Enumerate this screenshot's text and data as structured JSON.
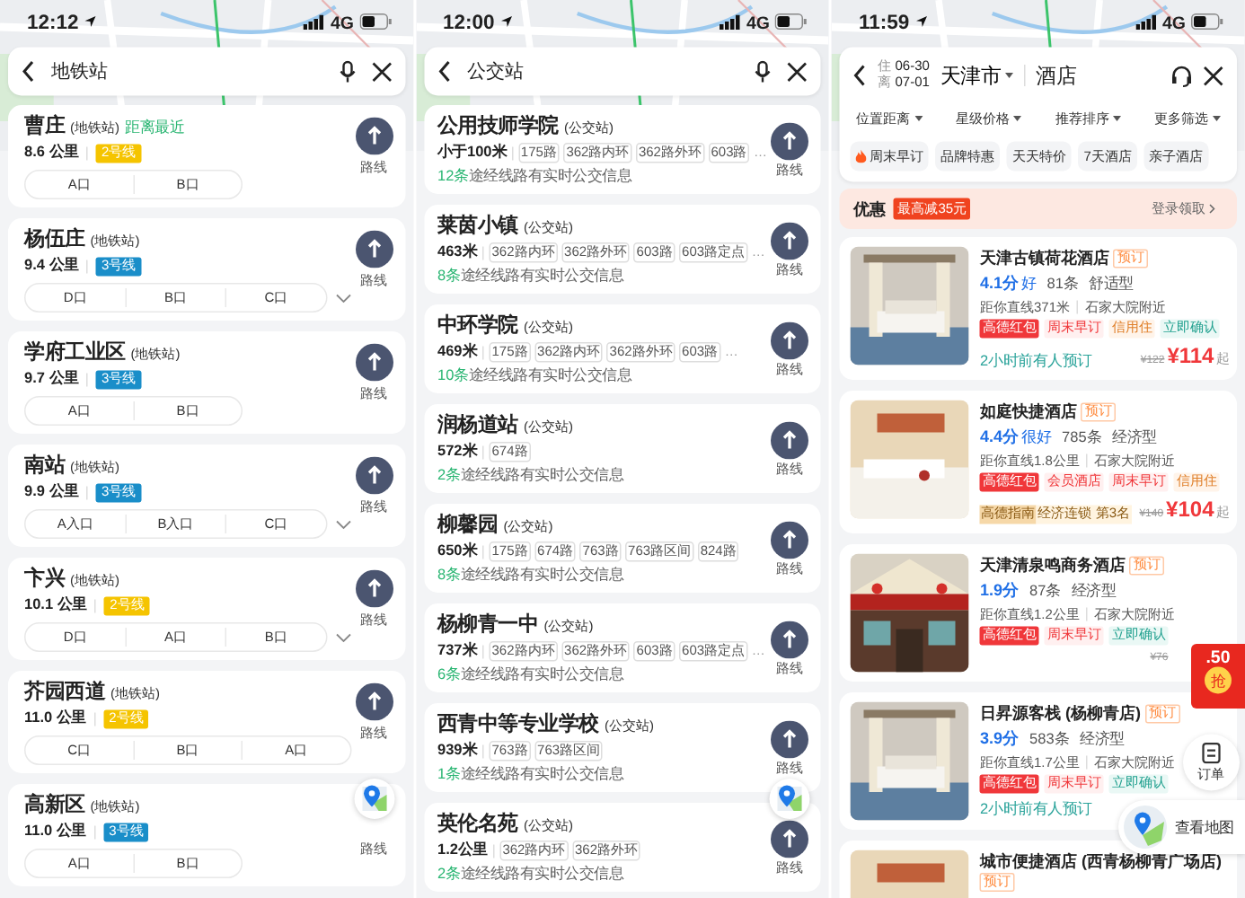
{
  "subway_screen": {
    "status_bar": {
      "time": "12:12",
      "network": "4G"
    },
    "search": {
      "query": "地铁站"
    },
    "stations": [
      {
        "name": "曹庄",
        "type": "(地铁站)",
        "note": "距离最近",
        "distance": "8.6 公里",
        "line": {
          "label": "2号线",
          "color": "#f5c400"
        },
        "exits": [
          "A口",
          "B口"
        ],
        "expandable": false,
        "route_label": "路线",
        "route_icon": true
      },
      {
        "name": "杨伍庄",
        "type": "(地铁站)",
        "distance": "9.4 公里",
        "line": {
          "label": "3号线",
          "color": "#1a8ec9"
        },
        "exits": [
          "D口",
          "B口",
          "C口"
        ],
        "expandable": true,
        "route_label": "路线",
        "route_icon": true
      },
      {
        "name": "学府工业区",
        "type": "(地铁站)",
        "distance": "9.7 公里",
        "line": {
          "label": "3号线",
          "color": "#1a8ec9"
        },
        "exits": [
          "A口",
          "B口"
        ],
        "expandable": false,
        "route_label": "路线",
        "route_icon": true
      },
      {
        "name": "南站",
        "type": "(地铁站)",
        "distance": "9.9 公里",
        "line": {
          "label": "3号线",
          "color": "#1a8ec9"
        },
        "exits": [
          "A入口",
          "B入口",
          "C口"
        ],
        "expandable": true,
        "route_label": "路线",
        "route_icon": true
      },
      {
        "name": "卞兴",
        "type": "(地铁站)",
        "distance": "10.1 公里",
        "line": {
          "label": "2号线",
          "color": "#f5c400"
        },
        "exits": [
          "D口",
          "A口",
          "B口"
        ],
        "expandable": true,
        "route_label": "路线",
        "route_icon": true
      },
      {
        "name": "芥园西道",
        "type": "(地铁站)",
        "distance": "11.0 公里",
        "line": {
          "label": "2号线",
          "color": "#f5c400"
        },
        "exits": [
          "C口",
          "B口",
          "A口"
        ],
        "expandable": false,
        "route_label": "路线",
        "route_icon": true
      },
      {
        "name": "高新区",
        "type": "(地铁站)",
        "distance": "11.0 公里",
        "line": {
          "label": "3号线",
          "color": "#1a8ec9"
        },
        "exits": [
          "A口",
          "B口"
        ],
        "expandable": false,
        "route_label": "路线",
        "route_icon": false
      }
    ]
  },
  "bus_screen": {
    "status_bar": {
      "time": "12:00",
      "network": "4G"
    },
    "search": {
      "query": "公交站"
    },
    "stops": [
      {
        "name": "公用技师学院",
        "type": "(公交站)",
        "distance": "小于100米",
        "routes": [
          "175路",
          "362路内环",
          "362路外环",
          "603路"
        ],
        "more": "…",
        "count": "12条",
        "info": "途经线路有实时公交信息",
        "route_label": "路线"
      },
      {
        "name": "莱茵小镇",
        "type": "(公交站)",
        "distance": "463米",
        "routes": [
          "362路内环",
          "362路外环",
          "603路",
          "603路定点"
        ],
        "more": "…",
        "count": "8条",
        "info": "途经线路有实时公交信息",
        "route_label": "路线"
      },
      {
        "name": "中环学院",
        "type": "(公交站)",
        "distance": "469米",
        "routes": [
          "175路",
          "362路内环",
          "362路外环",
          "603路"
        ],
        "more": "…",
        "count": "10条",
        "info": "途经线路有实时公交信息",
        "route_label": "路线"
      },
      {
        "name": "润杨道站",
        "type": "(公交站)",
        "distance": "572米",
        "routes": [
          "674路"
        ],
        "count": "2条",
        "info": "途经线路有实时公交信息",
        "route_label": "路线"
      },
      {
        "name": "柳馨园",
        "type": "(公交站)",
        "distance": "650米",
        "routes": [
          "175路",
          "674路",
          "763路",
          "763路区间",
          "824路"
        ],
        "count": "8条",
        "info": "途经线路有实时公交信息",
        "route_label": "路线"
      },
      {
        "name": "杨柳青一中",
        "type": "(公交站)",
        "distance": "737米",
        "routes": [
          "362路内环",
          "362路外环",
          "603路",
          "603路定点"
        ],
        "more": "…",
        "count": "6条",
        "info": "途经线路有实时公交信息",
        "route_label": "路线"
      },
      {
        "name": "西青中等专业学校",
        "type": "(公交站)",
        "distance": "939米",
        "routes": [
          "763路",
          "763路区间"
        ],
        "count": "1条",
        "info": "途经线路有实时公交信息",
        "route_label": "路线"
      },
      {
        "name": "英伦名苑",
        "type": "(公交站)",
        "distance": "1.2公里",
        "routes": [
          "362路内环",
          "362路外环"
        ],
        "count": "2条",
        "info": "途经线路有实时公交信息",
        "route_label": "路线"
      }
    ]
  },
  "hotel_screen": {
    "status_bar": {
      "time": "11:59",
      "network": "4G"
    },
    "header": {
      "check_in_label": "住",
      "check_in": "06-30",
      "check_out_label": "离",
      "check_out": "07-01",
      "city": "天津市",
      "category": "酒店"
    },
    "filters": [
      "位置距离",
      "星级价格",
      "推荐排序",
      "更多筛选"
    ],
    "chips": [
      {
        "label": "周末早订",
        "hot": true
      },
      {
        "label": "品牌特惠",
        "hot": false
      },
      {
        "label": "天天特价",
        "hot": false
      },
      {
        "label": "7天酒店",
        "hot": false
      },
      {
        "label": "亲子酒店",
        "hot": false
      }
    ],
    "promo": {
      "title": "优惠",
      "badge": "最高减35元",
      "action": "登录领取"
    },
    "hotels": [
      {
        "name": "天津古镇荷花酒店",
        "badge": "预订",
        "score": "4.1分",
        "rating": "好",
        "reviews": "81条",
        "class": "舒适型",
        "distance": "距你直线371米",
        "area": "石家大院附近",
        "tags": [
          {
            "label": "高德红包",
            "kind": "red_packet"
          },
          {
            "label": "周末早订",
            "kind": "promo"
          },
          {
            "label": "信用住",
            "kind": "credit"
          },
          {
            "label": "立即确认",
            "kind": "confirm"
          }
        ],
        "recent": "2小时前有人预订",
        "price": {
          "old": "¥122",
          "new": "¥114",
          "suffix": "起"
        }
      },
      {
        "name": "如庭快捷酒店",
        "badge": "预订",
        "score": "4.4分",
        "rating": "很好",
        "reviews": "785条",
        "class": "经济型",
        "distance": "距你直线1.8公里",
        "area": "石家大院附近",
        "tags": [
          {
            "label": "高德红包",
            "kind": "red_packet"
          },
          {
            "label": "会员酒店",
            "kind": "member"
          },
          {
            "label": "周末早订",
            "kind": "promo"
          },
          {
            "label": "信用住",
            "kind": "credit"
          }
        ],
        "rank": {
          "source": "高德指南",
          "text": "经济连锁 第3名"
        },
        "price": {
          "old": "¥140",
          "new": "¥104",
          "suffix": "起"
        }
      },
      {
        "name": "天津清泉鸣商务酒店",
        "badge": "预订",
        "score": "1.9分",
        "reviews": "87条",
        "class": "经济型",
        "distance": "距你直线1.2公里",
        "area": "石家大院附近",
        "tags": [
          {
            "label": "高德红包",
            "kind": "red_packet"
          },
          {
            "label": "周末早订",
            "kind": "promo"
          },
          {
            "label": "立即确认",
            "kind": "confirm"
          }
        ],
        "price": {
          "old": "¥76"
        }
      },
      {
        "name": "日昇源客栈 (杨柳青店)",
        "badge": "预订",
        "score": "3.9分",
        "reviews": "583条",
        "class": "经济型",
        "distance": "距你直线1.7公里",
        "area": "石家大院附近",
        "tags": [
          {
            "label": "高德红包",
            "kind": "red_packet"
          },
          {
            "label": "周末早订",
            "kind": "promo"
          },
          {
            "label": "立即确认",
            "kind": "confirm"
          }
        ],
        "recent": "2小时前有人预订"
      },
      {
        "name": "城市便捷酒店 (西青杨柳青广场店)",
        "badge": "预订"
      }
    ],
    "red_packet": {
      "amount": ".50",
      "action": "抢"
    },
    "order_button": "订单",
    "map_button": "查看地图"
  }
}
